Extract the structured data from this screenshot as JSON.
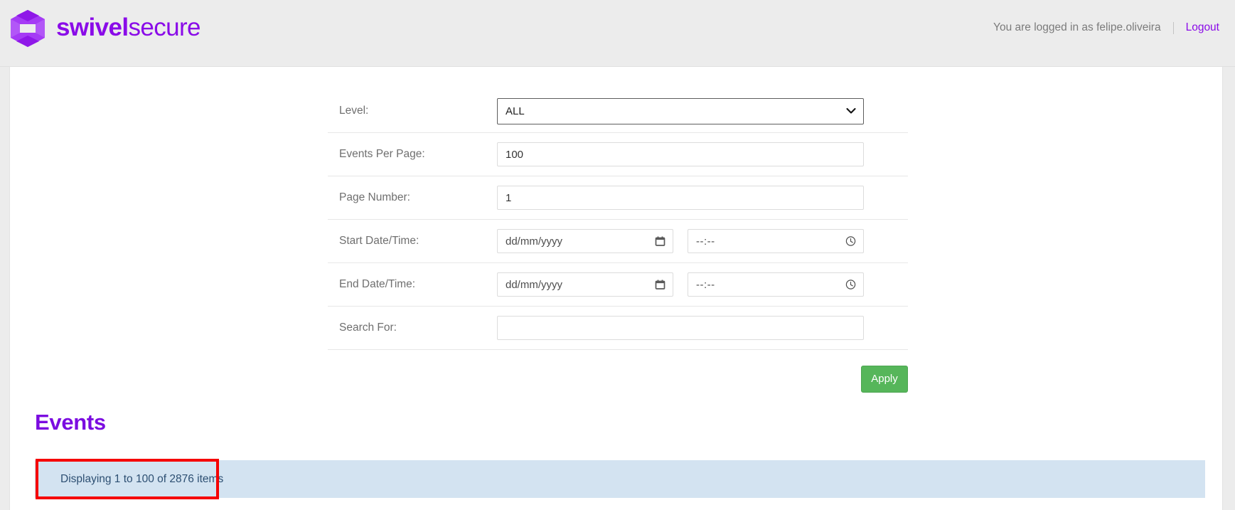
{
  "header": {
    "logo_icon": "swivel-hexagon-s-logo-icon",
    "brand_bold": "swivel",
    "brand_light": "secure",
    "brand_color": "#8A0BE8",
    "session_text": "You are logged in as felipe.oliveira",
    "logout_label": "Logout"
  },
  "form": {
    "rows": [
      {
        "label": "Level:",
        "type": "select",
        "value": "ALL",
        "icon": "chevron-down-icon"
      },
      {
        "label": "Events Per Page:",
        "type": "text",
        "value": "100",
        "placeholder": ""
      },
      {
        "label": "Page Number:",
        "type": "text",
        "value": "1",
        "placeholder": ""
      },
      {
        "label": "Start Date/Time:",
        "type": "datetime",
        "date_placeholder": "dd/mm/yyyy",
        "date_icon": "calendar-icon",
        "time_placeholder": "--:--",
        "time_icon": "clock-icon"
      },
      {
        "label": "End Date/Time:",
        "type": "datetime",
        "date_placeholder": "dd/mm/yyyy",
        "date_icon": "calendar-icon",
        "time_placeholder": "--:--",
        "time_icon": "clock-icon"
      },
      {
        "label": "Search For:",
        "type": "text",
        "value": "",
        "placeholder": ""
      }
    ],
    "apply_label": "Apply",
    "apply_color": "#56b65a"
  },
  "events": {
    "heading": "Events",
    "heading_color": "#7b0ce0",
    "info_text": "Displaying 1 to 100 of 2876 items",
    "info_bar_color": "#d3e3f1",
    "annotation_color": "#f50000",
    "displaying_from": 1,
    "displaying_to": 100,
    "total_items": 2876
  }
}
